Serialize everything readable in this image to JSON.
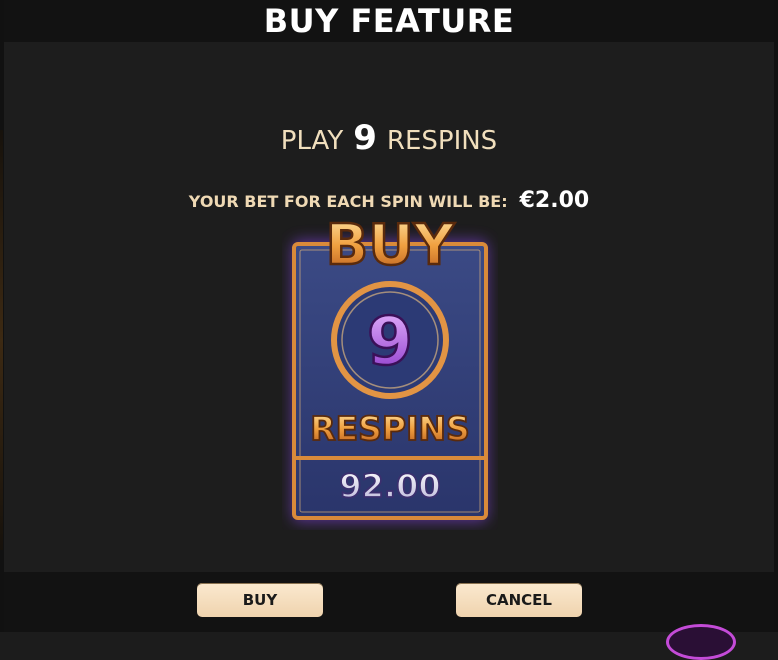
{
  "dialog": {
    "title": "BUY FEATURE",
    "play_prefix": "PLAY",
    "play_count": "9",
    "play_suffix": "RESPINS",
    "bet_label": "YOUR BET FOR EACH SPIN WILL BE:",
    "bet_value": "€2.00"
  },
  "card": {
    "heading": "BUY",
    "count": "9",
    "label": "RESPINS",
    "price": "92.00"
  },
  "buttons": {
    "buy_label": "BUY",
    "cancel_label": "CANCEL"
  },
  "colors": {
    "cream": "#f1dfbd",
    "button_bg": "#f7e0c0",
    "card_panel": "#34427a",
    "card_border": "#d98a3a",
    "glow": "#8a4bd6",
    "count_purple": "#b75ae0"
  }
}
